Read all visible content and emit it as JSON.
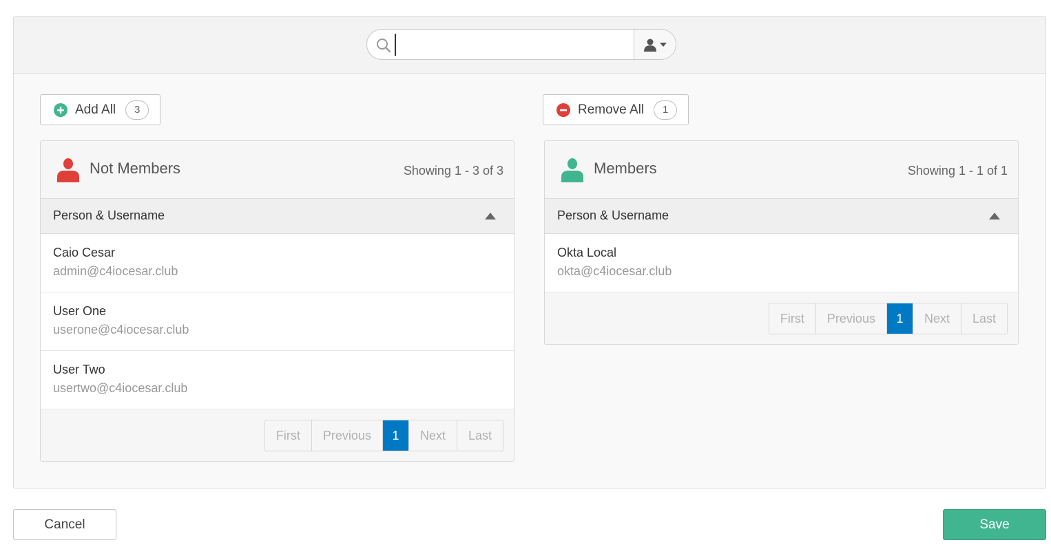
{
  "search": {
    "value": "",
    "placeholder": ""
  },
  "bulk": {
    "add_all_label": "Add All",
    "add_all_count": "3",
    "remove_all_label": "Remove All",
    "remove_all_count": "1"
  },
  "not_members": {
    "title": "Not Members",
    "showing": "Showing 1 - 3 of 3",
    "column": "Person & Username",
    "rows": [
      {
        "name": "Caio Cesar",
        "email": "admin@c4iocesar.club"
      },
      {
        "name": "User One",
        "email": "userone@c4iocesar.club"
      },
      {
        "name": "User Two",
        "email": "usertwo@c4iocesar.club"
      }
    ],
    "pager": {
      "first": "First",
      "previous": "Previous",
      "page": "1",
      "next": "Next",
      "last": "Last"
    }
  },
  "members": {
    "title": "Members",
    "showing": "Showing 1 - 1 of 1",
    "column": "Person & Username",
    "rows": [
      {
        "name": "Okta Local",
        "email": "okta@c4iocesar.club"
      }
    ],
    "pager": {
      "first": "First",
      "previous": "Previous",
      "page": "1",
      "next": "Next",
      "last": "Last"
    }
  },
  "footer": {
    "cancel_label": "Cancel",
    "save_label": "Save"
  },
  "icons": {
    "search": "search-icon",
    "user_filter": "person-icon",
    "caret": "caret-down-icon",
    "add": "plus-circle-icon",
    "remove": "minus-circle-icon",
    "not_members": "person-icon",
    "members": "person-icon",
    "sort": "sort-asc-icon"
  },
  "colors": {
    "add_green": "#41b590",
    "remove_red": "#e0403a",
    "not_members_red": "#e0403a",
    "members_green": "#41b590",
    "active_page_blue": "#0079c5",
    "save_green": "#41b590"
  }
}
